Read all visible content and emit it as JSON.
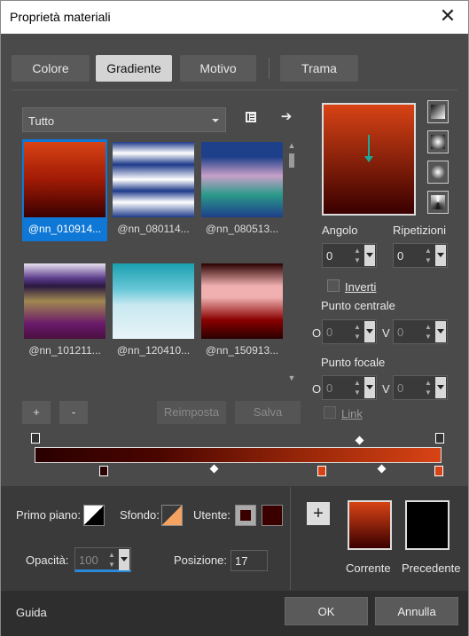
{
  "window": {
    "title": "Proprietà materiali",
    "close": "✕"
  },
  "tabs": [
    {
      "label": "Colore",
      "selected": false
    },
    {
      "label": "Gradiente",
      "selected": true
    },
    {
      "label": "Motivo",
      "selected": false
    },
    {
      "label": "Trama",
      "selected": false
    }
  ],
  "category": {
    "value": "Tutto"
  },
  "gradients": [
    {
      "name": "@nn_010914...",
      "selected": true,
      "colors": "#d84315,#a01a05,#3a0000"
    },
    {
      "name": "@nn_080114...",
      "selected": false,
      "colors": "#ffffff,#1e3a8a,#ffffff,#1e3a8a,#ffffff,#1e3a8a"
    },
    {
      "name": "@nn_080513...",
      "selected": false,
      "colors": "#1e3f8a,#c8a0c8,#2a9a8a,#1e3f8a"
    },
    {
      "name": "@nn_101211...",
      "selected": false,
      "colors": "#e8e0f0,#5a3a8a,#a08850,#6a1a6a,#4a1040"
    },
    {
      "name": "@nn_120410...",
      "selected": false,
      "colors": "#1aa0b0,#c8e8f0,#e8f4f8"
    },
    {
      "name": "@nn_150913...",
      "selected": false,
      "colors": "#2a0000,#f0b0b0,#8a0000,#2a0000"
    }
  ],
  "buttons": {
    "add": "+",
    "remove": "-",
    "reset": "Reimposta",
    "save": "Salva"
  },
  "fields": {
    "angle_label": "Angolo",
    "angle_value": "0",
    "repeats_label": "Ripetizioni",
    "repeats_value": "0",
    "invert_label": "Inverti",
    "center_label": "Punto centrale",
    "center_o_label": "O",
    "center_o_value": "0",
    "center_v_label": "V",
    "center_v_value": "0",
    "focal_label": "Punto focale",
    "focal_o_label": "O",
    "focal_o_value": "0",
    "focal_v_label": "V",
    "focal_v_value": "0",
    "link_label": "Link"
  },
  "colors_panel": {
    "primo_label": "Primo piano:",
    "sfondo_label": "Sfondo:",
    "utente_label": "Utente:",
    "utente_color": "#3a0000",
    "opacity_label": "Opacità:",
    "opacity_value": "100",
    "position_label": "Posizione:",
    "position_value": "17",
    "add_label": "+",
    "current_label": "Corrente",
    "current_colors": "#d84315,#3a0000",
    "previous_label": "Precedente",
    "previous_color": "#000000"
  },
  "footer": {
    "help": "Guida",
    "ok": "OK",
    "cancel": "Annulla"
  }
}
